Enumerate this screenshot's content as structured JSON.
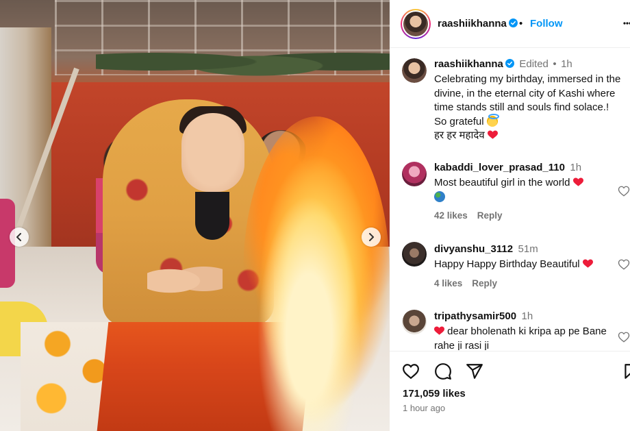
{
  "media": {
    "prev_icon": "chevron-left-icon",
    "next_icon": "chevron-right-icon"
  },
  "header": {
    "username": "raashiikhanna",
    "dot": "•",
    "follow_label": "Follow",
    "more_icon": "more-horizontal-icon",
    "verified_icon": "verified-badge-icon"
  },
  "caption": {
    "username": "raashiikhanna",
    "edited": "Edited",
    "dot": "•",
    "time": "1h",
    "text": "Celebrating my birthday, immersed in the divine, in the eternal city of Kashi where time stands still and souls find solace.! So grateful",
    "line2": "हर हर महादेव"
  },
  "comments": [
    {
      "username": "kabaddi_lover_prasad_110",
      "time": "1h",
      "text": "Most beautiful girl in the world",
      "likes": "42 likes",
      "reply": "Reply"
    },
    {
      "username": "divyanshu_3112",
      "time": "51m",
      "text": "Happy Happy Birthday Beautiful",
      "likes": "4 likes",
      "reply": "Reply"
    },
    {
      "username": "tripathysamir500",
      "time": "1h",
      "text": "dear bholenath ki kripa ap pe Bane rahe ji rasi ji"
    }
  ],
  "actions": {
    "like_icon": "heart-icon",
    "comment_icon": "comment-icon",
    "share_icon": "share-icon",
    "save_icon": "bookmark-icon",
    "likes": "171,059 likes",
    "posted": "1 hour ago"
  },
  "colors": {
    "accent": "#0095f6",
    "heart": "#ed1c3a",
    "muted": "#737373"
  }
}
